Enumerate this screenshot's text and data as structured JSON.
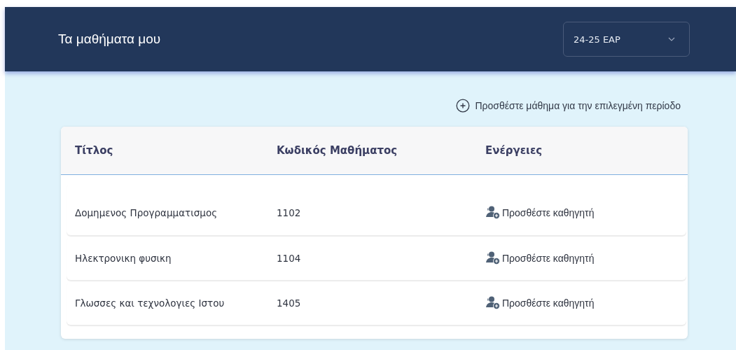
{
  "header": {
    "title": "Τα μαθήματα μου",
    "period_select": {
      "value": "24-25 ΕΑΡ"
    }
  },
  "add_course_link": {
    "label": "Προσθέστε μάθημα για την επιλεγμένη περίοδο"
  },
  "table": {
    "columns": [
      "Τίτλος",
      "Κωδικός Μαθήματος",
      "Ενέργειες"
    ],
    "rows": [
      {
        "title": "Δομημενος Προγραμματισμος",
        "code": "1102",
        "action": "Προσθέστε καθηγητή"
      },
      {
        "title": "Ηλεκτρονικη φυσικη",
        "code": "1104",
        "action": "Προσθέστε καθηγητή"
      },
      {
        "title": "Γλωσσες και τεχνολογιες Ιστου",
        "code": "1405",
        "action": "Προσθέστε καθηγητή"
      }
    ]
  }
}
